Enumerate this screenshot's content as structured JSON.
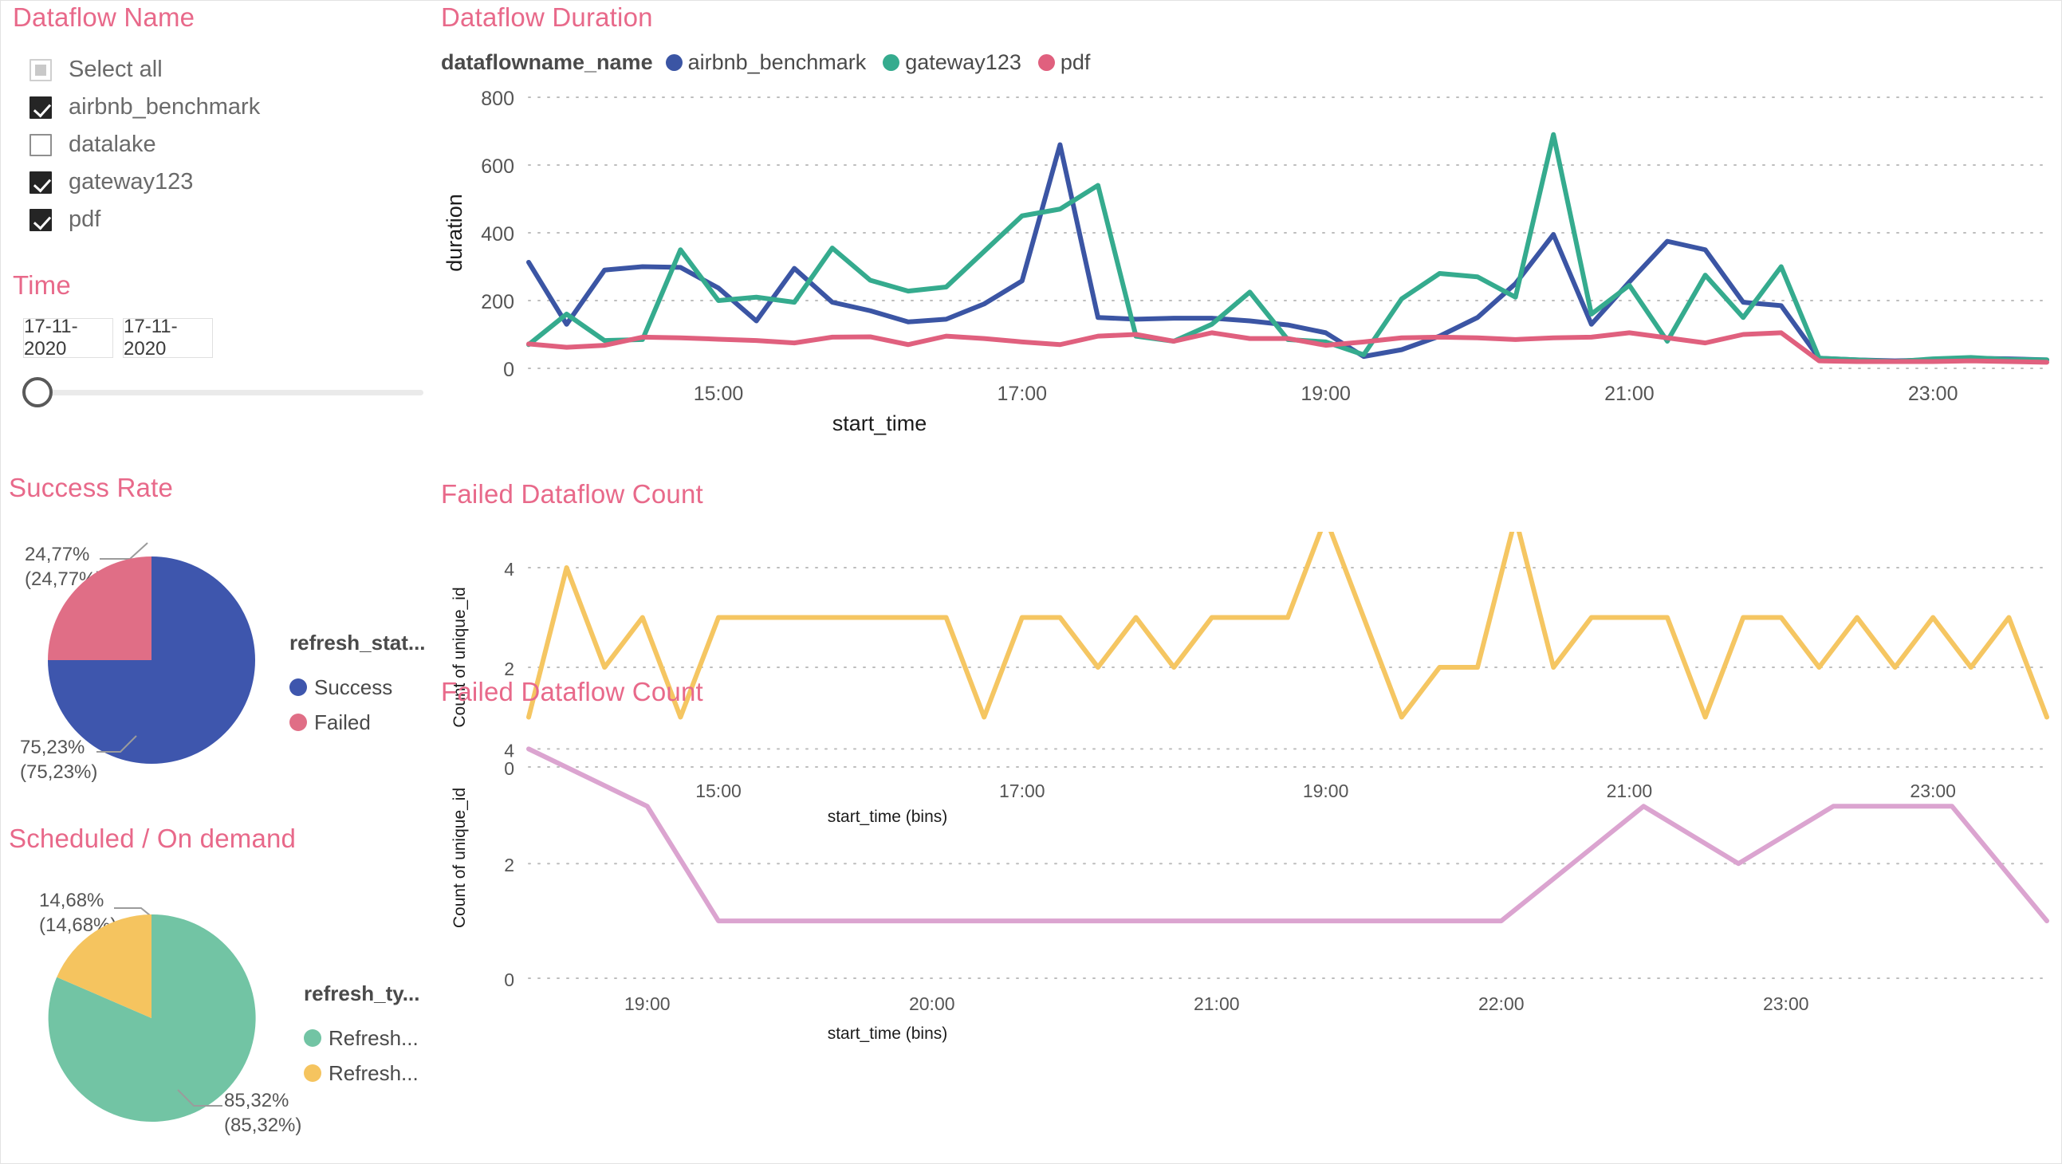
{
  "colors": {
    "title_pink": "#e8698a",
    "blue": "#3b55a4",
    "green": "#35ab8e",
    "red": "#e0607e",
    "pie_blue": "#3e56ad",
    "pie_red": "#e06e86",
    "pie_green": "#72c4a4",
    "pie_yellow": "#f5c45f",
    "yellow_line": "#f5c662",
    "pink_line": "#dba4d0",
    "grid": "#c9c9c9",
    "text_gray": "#6a6a6a"
  },
  "slicer": {
    "title": "Dataflow Name",
    "items": [
      {
        "label": "Select all",
        "state": "partial"
      },
      {
        "label": "airbnb_benchmark",
        "state": "checked"
      },
      {
        "label": "datalake",
        "state": "unchecked"
      },
      {
        "label": "gateway123",
        "state": "checked"
      },
      {
        "label": "pdf",
        "state": "checked"
      }
    ]
  },
  "time": {
    "title": "Time",
    "start_date": "17-11-2020",
    "end_date": "17-11-2020",
    "slider_value": 0
  },
  "success_rate": {
    "title": "Success Rate",
    "legend_title": "refresh_stat...",
    "callout_top": "24,77%\n(24,77%)",
    "callout_top_line1": "24,77%",
    "callout_top_line2": "(24,77%)",
    "callout_bottom_line1": "75,23%",
    "callout_bottom_line2": "(75,23%)",
    "legend": [
      {
        "label": "Success",
        "color": "#3e56ad"
      },
      {
        "label": "Failed",
        "color": "#e06e86"
      }
    ]
  },
  "scheduled": {
    "title": "Scheduled / On demand",
    "legend_title": "refresh_ty...",
    "callout_top_line1": "14,68%",
    "callout_top_line2": "(14,68%)",
    "callout_bottom_line1": "85,32%",
    "callout_bottom_line2": "(85,32%)",
    "legend": [
      {
        "label": "Refresh...",
        "color": "#72c4a4"
      },
      {
        "label": "Refresh...",
        "color": "#f5c45f"
      }
    ]
  },
  "duration_chart": {
    "title": "Dataflow Duration",
    "legend_title": "dataflowname_name"
  },
  "failed_chart_1": {
    "title": "Failed Dataflow Count"
  },
  "failed_chart_2": {
    "title": "Failed Dataflow Count"
  },
  "chart_data": [
    {
      "id": "dataflow-duration",
      "type": "line",
      "title": "Dataflow Duration",
      "xlabel": "start_time",
      "ylabel": "duration",
      "ylim": [
        0,
        800
      ],
      "yticks": [
        0,
        200,
        400,
        600,
        800
      ],
      "xticks": [
        "15:00",
        "17:00",
        "19:00",
        "21:00",
        "23:00"
      ],
      "xlim": [
        "13:45",
        "23:55"
      ],
      "grid": "dotted-horizontal",
      "legend_position": "top",
      "legend_title": "dataflowname_name",
      "x": [
        "13:45",
        "14:00",
        "14:15",
        "14:30",
        "14:45",
        "15:00",
        "15:15",
        "15:30",
        "15:45",
        "16:00",
        "16:15",
        "16:30",
        "16:45",
        "17:00",
        "17:15",
        "17:30",
        "17:45",
        "18:00",
        "18:15",
        "18:30",
        "18:45",
        "19:00",
        "19:15",
        "19:30",
        "19:45",
        "20:00",
        "20:15",
        "20:30",
        "20:45",
        "21:00",
        "21:15",
        "21:30",
        "21:45",
        "22:00",
        "22:15",
        "22:30",
        "22:45",
        "23:00",
        "23:15",
        "23:30",
        "23:45"
      ],
      "series": [
        {
          "name": "airbnb_benchmark",
          "color": "#3b55a4",
          "values": [
            313,
            130,
            290,
            300,
            298,
            237,
            140,
            295,
            195,
            170,
            137,
            145,
            190,
            258,
            660,
            150,
            145,
            148,
            148,
            140,
            128,
            105,
            35,
            55,
            95,
            150,
            250,
            395,
            130,
            255,
            375,
            350,
            195,
            185,
            30,
            25,
            22,
            25,
            30,
            28,
            25
          ]
        },
        {
          "name": "gateway123",
          "color": "#35ab8e",
          "values": [
            70,
            160,
            82,
            85,
            350,
            200,
            210,
            195,
            355,
            260,
            228,
            240,
            345,
            450,
            470,
            540,
            95,
            80,
            130,
            225,
            85,
            78,
            40,
            205,
            280,
            270,
            210,
            690,
            160,
            245,
            80,
            275,
            150,
            300,
            30,
            25,
            20,
            28,
            32,
            26,
            25
          ]
        },
        {
          "name": "pdf",
          "color": "#e0607e",
          "values": [
            72,
            62,
            68,
            92,
            90,
            86,
            82,
            75,
            92,
            93,
            70,
            95,
            88,
            78,
            70,
            95,
            100,
            80,
            105,
            88,
            88,
            68,
            78,
            90,
            92,
            90,
            85,
            90,
            92,
            105,
            90,
            75,
            100,
            105,
            22,
            20,
            20,
            20,
            22,
            20,
            18
          ]
        }
      ]
    },
    {
      "id": "failed-count-bins-1",
      "type": "line",
      "title": "Failed Dataflow Count",
      "xlabel": "start_time (bins)",
      "ylabel": "Count of unique_id",
      "ylim": [
        0,
        4.4
      ],
      "yticks": [
        0,
        2,
        4
      ],
      "xticks": [
        "15:00",
        "17:00",
        "19:00",
        "21:00",
        "23:00"
      ],
      "grid": "dotted-horizontal",
      "line_color": "#f5c662",
      "x": [
        "13:45",
        "14:00",
        "14:15",
        "14:30",
        "14:45",
        "15:00",
        "15:15",
        "15:30",
        "15:45",
        "16:00",
        "16:15",
        "16:30",
        "16:45",
        "17:00",
        "17:15",
        "17:30",
        "17:45",
        "18:00",
        "18:15",
        "18:30",
        "18:45",
        "19:00",
        "19:15",
        "19:30",
        "19:45",
        "20:00",
        "20:15",
        "20:30",
        "20:45",
        "21:00",
        "21:15",
        "21:30",
        "21:45",
        "22:00",
        "22:15",
        "22:30",
        "22:45",
        "23:00",
        "23:15",
        "23:30",
        "23:45"
      ],
      "values": [
        1,
        4,
        2,
        3,
        1,
        3,
        3,
        3,
        3,
        3,
        3,
        3,
        1,
        3,
        3,
        2,
        3,
        2,
        3,
        3,
        3,
        5,
        3,
        1,
        2,
        2,
        5,
        2,
        3,
        3,
        3,
        1,
        3,
        3,
        2,
        3,
        2,
        3,
        2,
        3,
        1
      ]
    },
    {
      "id": "failed-count-bins-2",
      "type": "line",
      "title": "Failed Dataflow Count",
      "xlabel": "start_time (bins)",
      "ylabel": "Count of unique_id",
      "ylim": [
        0,
        4.2
      ],
      "yticks": [
        0,
        2,
        4
      ],
      "xticks": [
        "19:00",
        "20:00",
        "21:00",
        "22:00",
        "23:00"
      ],
      "grid": "dotted-horizontal",
      "line_color": "#dba4d0",
      "x": [
        "18:35",
        "19:00",
        "19:15",
        "19:30",
        "20:00",
        "21:00",
        "22:00",
        "22:30",
        "22:50",
        "23:10",
        "23:35",
        "23:55"
      ],
      "values": [
        4,
        3,
        1,
        1,
        1,
        1,
        1,
        3,
        2,
        3,
        3,
        1
      ]
    }
  ]
}
